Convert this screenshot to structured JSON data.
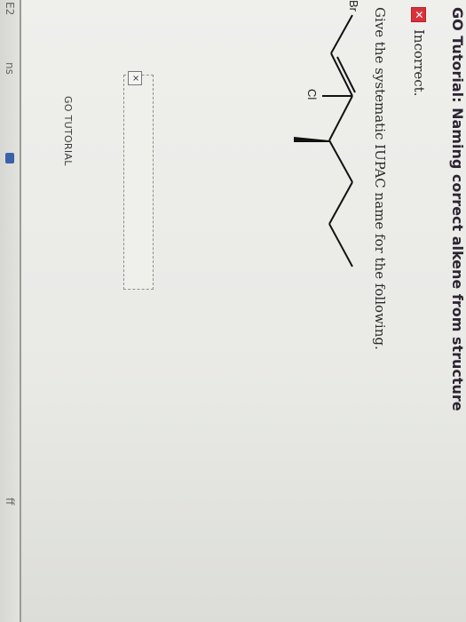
{
  "left_edge": {
    "top_label": "E2",
    "mid_label": "ns",
    "bottom_label": "ff"
  },
  "header": {
    "title": "GO Tutorial: Naming correct alkene from structure"
  },
  "feedback": {
    "icon": "x-mark-icon",
    "status": "Incorrect."
  },
  "question": {
    "prompt": "Give the systematic IUPAC name for the following."
  },
  "molecule": {
    "atom_labels": [
      "Br",
      "Cl"
    ]
  },
  "answer": {
    "value": "",
    "clear_glyph": "×"
  },
  "links": {
    "go_tutorial": "GO TUTORIAL"
  },
  "colors": {
    "incorrect_red": "#d9313a",
    "title_text": "#2d2533",
    "page_background": "#efefec"
  }
}
